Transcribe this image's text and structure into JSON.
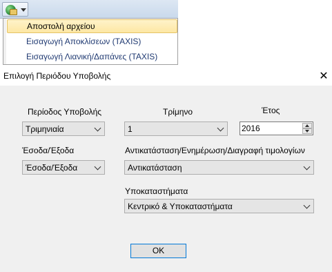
{
  "toolbar": {
    "icon": "send-file-icon",
    "arrow_icon": "chevron-down-icon"
  },
  "menu": {
    "items": [
      {
        "label": "Αποστολή αρχείου",
        "selected": true
      },
      {
        "label": "Εισαγωγή Αποκλίσεων (TAXIS)",
        "selected": false
      },
      {
        "label": "Εισαγωγή Λιανική/Δαπάνες (TAXIS)",
        "selected": false
      }
    ]
  },
  "dialog": {
    "title": "Επιλογή Περιόδου Υποβολής",
    "close_icon": "close-icon",
    "period_label": "Περίοδος Υποβολής",
    "period_value": "Τριμηνιαία",
    "quarter_label": "Τρίμηνο",
    "quarter_value": "1",
    "year_label": "Έτος",
    "year_value": "2016",
    "inout_label": "Έσοδα/Έξοδα",
    "inout_value": "Έσοδα/Έξοδα",
    "action_label": "Αντικατάσταση/Ενημέρωση/Διαγραφή  τιμολογίων",
    "action_value": "Αντικατάσταση",
    "branches_label": "Υποκαταστήματα",
    "branches_value": "Κεντρικό & Υποκαταστήματα",
    "ok_label": "OK"
  }
}
